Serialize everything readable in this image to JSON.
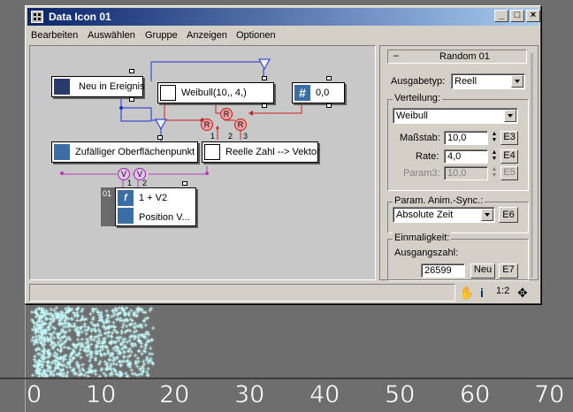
{
  "window": {
    "title": "Data Icon 01",
    "minimize": "_",
    "maximize": "□",
    "close": "×"
  },
  "menu": [
    "Bearbeiten",
    "Auswählen",
    "Gruppe",
    "Anzeigen",
    "Optionen"
  ],
  "nodes": {
    "neu": "Neu in Ereignis",
    "weibull": "Weibull(10,, 4,)",
    "const": "0,0",
    "zufall": "Zufälliger Oberflächenpunkt",
    "reelle": "Reelle Zahl --> Vektor",
    "func_num": "01",
    "func_expr": "1 + V2",
    "func_out": "Position V...",
    "port_R": "R",
    "port_V": "V",
    "port_1": "1",
    "port_2": "2",
    "port_3": "3"
  },
  "panel": {
    "header": "Random 01",
    "collapse": "–",
    "ausgabetyp_label": "Ausgabetyp:",
    "ausgabetyp_value": "Reell",
    "verteilung_title": "Verteilung:",
    "verteilung_value": "Weibull",
    "massstab_label": "Maßstab:",
    "massstab_value": "10,0",
    "massstab_btn": "E3",
    "rate_label": "Rate:",
    "rate_value": "4,0",
    "rate_btn": "E4",
    "param3_label": "Param3:",
    "param3_value": "10,0",
    "param3_btn": "E5",
    "sync_title": "Param. Anim.-Sync.:",
    "sync_value": "Absolute Zeit",
    "sync_btn": "E6",
    "einmal_title": "Einmaligkeit:",
    "ausgangszahl_label": "Ausgangszahl:",
    "ausgangszahl_value": "26599",
    "neu_btn": "Neu",
    "neu_code": "E7"
  },
  "viewport": {
    "ticks": [
      "0",
      "10",
      "20",
      "30",
      "40",
      "50",
      "60",
      "70"
    ],
    "particle_color": "#c8ffff"
  }
}
